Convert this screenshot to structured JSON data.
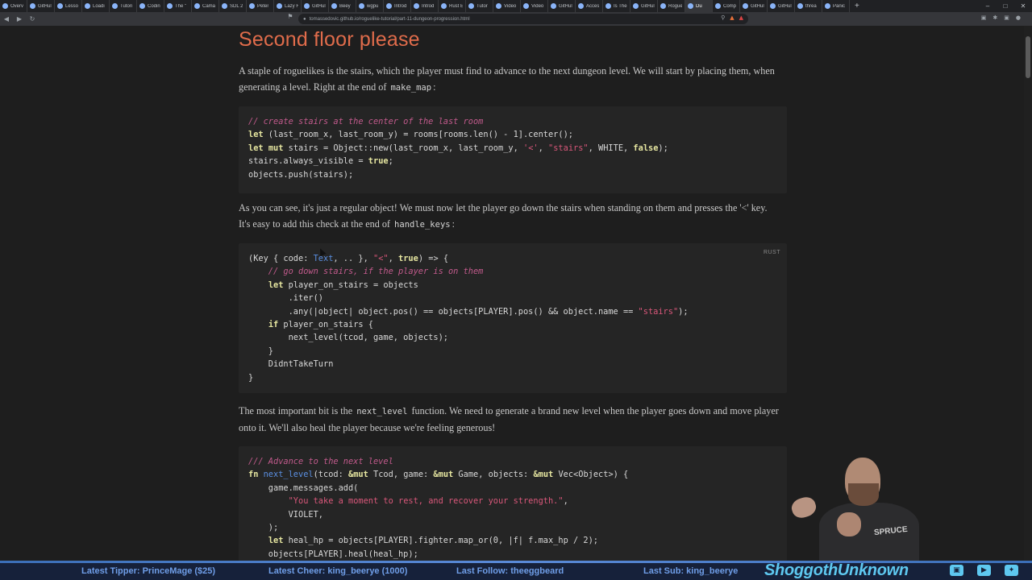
{
  "browser": {
    "tabs": [
      {
        "label": "Overv"
      },
      {
        "label": "GitHul"
      },
      {
        "label": "Lesso"
      },
      {
        "label": "Loadi"
      },
      {
        "label": "Tutori"
      },
      {
        "label": "Codin"
      },
      {
        "label": "The \""
      },
      {
        "label": "Cama"
      },
      {
        "label": "SDL 2"
      },
      {
        "label": "Peter"
      },
      {
        "label": "Lazy F"
      },
      {
        "label": "GitHul"
      },
      {
        "label": "Beey"
      },
      {
        "label": "wgpu"
      },
      {
        "label": "Introd"
      },
      {
        "label": "Introd"
      },
      {
        "label": "Rust E"
      },
      {
        "label": "Tutor"
      },
      {
        "label": "Video"
      },
      {
        "label": "Video"
      },
      {
        "label": "GitHul"
      },
      {
        "label": "Acces"
      },
      {
        "label": "Is The"
      },
      {
        "label": "GitHul"
      },
      {
        "label": "Rogue"
      },
      {
        "label": "Du"
      },
      {
        "label": "Comp"
      },
      {
        "label": "GitHul"
      },
      {
        "label": "GitHul"
      },
      {
        "label": "threa"
      },
      {
        "label": "Panic"
      }
    ],
    "active_tab_index": 25,
    "url": "tomassedovic.github.io/roguelike-tutorial/part-11-dungeon-progression.html"
  },
  "article": {
    "heading": "Second floor please",
    "p1_text": "A staple of roguelikes is the stairs, which the player must find to advance to the next dungeon level. We will start by placing them, when generating a level. Right at the end of ",
    "p1_code": "make_map",
    "p1_end": ":",
    "p2_text": "As you can see, it's just a regular object! We must now let the player go down the stairs when standing on them and presses the '<' key. It's easy to add this check at the end of ",
    "p2_code": "handle_keys",
    "p2_end": ":",
    "p3_text": "The most important bit is the ",
    "p3_code": "next_level",
    "p3_end": " function. We need to generate a brand new level when the player goes down and move player onto it. We'll also heal the player because we're feeling generous!",
    "code2_lang": "RUST"
  },
  "code1": {
    "l1": "// create stairs at the center of the last room",
    "l2a": "let",
    "l2b": " (last_room_x, last_room_y) = rooms[rooms.len() - 1].center();",
    "l3a": "let",
    "l3b": " ",
    "l3c": "mut",
    "l3d": " stairs = Object::new(last_room_x, last_room_y, ",
    "l3e": "'<'",
    "l3f": ", ",
    "l3g": "\"stairs\"",
    "l3h": ", WHITE, ",
    "l3i": "false",
    "l3j": ");",
    "l4a": "stairs.always_visible = ",
    "l4b": "true",
    "l4c": ";",
    "l5": "objects.push(stairs);"
  },
  "code2": {
    "l1a": "(Key { code: ",
    "l1b": "Text",
    "l1c": ", .. }, ",
    "l1d": "\"<\"",
    "l1e": ", ",
    "l1f": "true",
    "l1g": ") => {",
    "l2": "    // go down stairs, if the player is on them",
    "l3a": "    ",
    "l3b": "let",
    "l3c": " player_on_stairs = objects",
    "l4": "        .iter()",
    "l5a": "        .any(|object| object.pos() == objects[PLAYER].pos() && object.name == ",
    "l5b": "\"stairs\"",
    "l5c": ");",
    "l6a": "    ",
    "l6b": "if",
    "l6c": " player_on_stairs {",
    "l7": "        next_level(tcod, game, objects);",
    "l8": "    }",
    "l9": "    DidntTakeTurn",
    "l10": "}"
  },
  "code3": {
    "l1": "/// Advance to the next level",
    "l2a": "fn",
    "l2b": " ",
    "l2c": "next_level",
    "l2d": "(tcod: ",
    "l2e": "&mut",
    "l2f": " Tcod, game: ",
    "l2g": "&mut",
    "l2h": " Game, objects: ",
    "l2i": "&mut",
    "l2j": " Vec<Object>) {",
    "l3": "    game.messages.add(",
    "l4a": "        ",
    "l4b": "\"You take a moment to rest, and recover your strength.\"",
    "l4c": ",",
    "l5": "        VIOLET,",
    "l6": "    );",
    "l7a": "    ",
    "l7b": "let",
    "l7c": " heal_hp = objects[PLAYER].fighter.map_or(0, |f| f.max_hp / 2);",
    "l8": "    objects[PLAYER].heal(heal_hp);"
  },
  "stream": {
    "tipper": "Latest Tipper: PrinceMage ($25)",
    "cheer": "Latest Cheer: king_beerye (1000)",
    "follow": "Last Follow: theeggbeard",
    "sub": "Last Sub: king_beerye",
    "channel": "ShoggothUnknown",
    "shirt_text": "SPRUCE",
    "icons": [
      "twitch-icon",
      "youtube-icon",
      "twitter-icon"
    ]
  },
  "colors": {
    "heading": "#e06c4b",
    "comment": "#c25a8c",
    "keyword": "#e6e6a0",
    "string": "#d9577a",
    "function": "#5a8ee0",
    "ticker_text": "#6f9ee8",
    "brand": "#5ec8f0"
  }
}
